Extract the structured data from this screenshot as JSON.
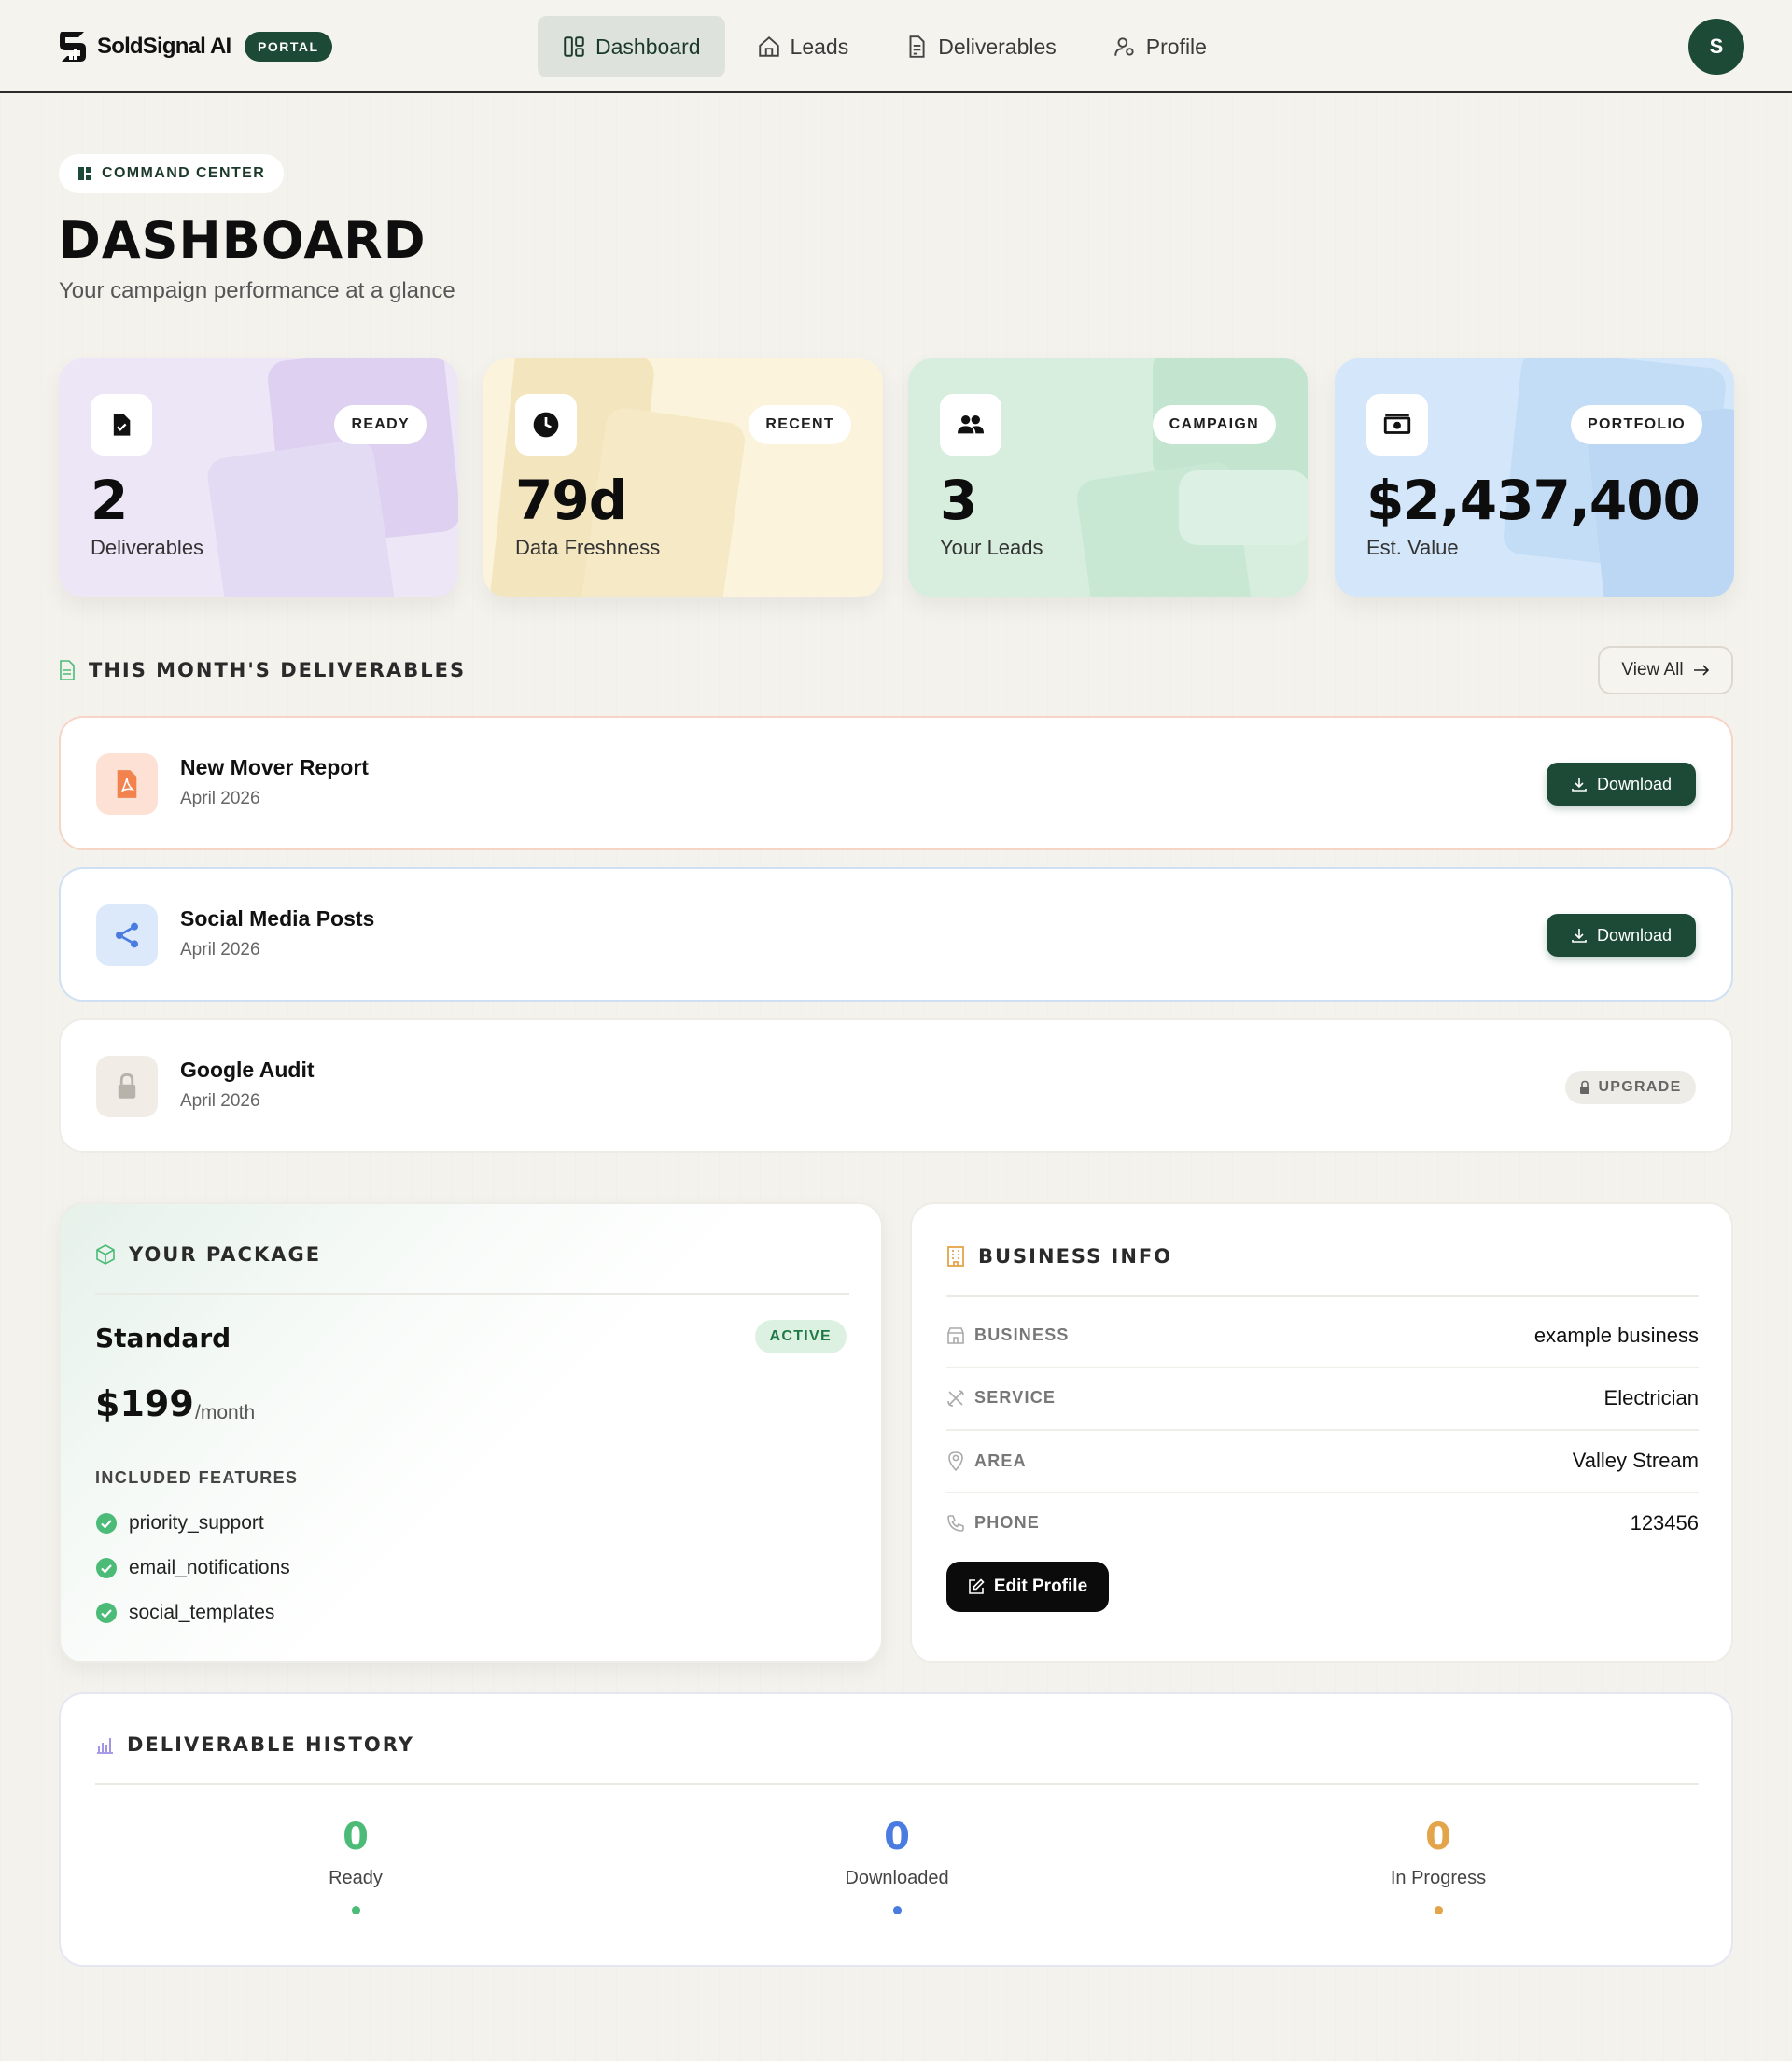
{
  "header": {
    "brand": "SoldSignal AI",
    "portal_badge": "PORTAL",
    "nav": [
      {
        "label": "Dashboard",
        "icon": "layout-icon",
        "active": true
      },
      {
        "label": "Leads",
        "icon": "home-icon",
        "active": false
      },
      {
        "label": "Deliverables",
        "icon": "document-icon",
        "active": false
      },
      {
        "label": "Profile",
        "icon": "user-gear-icon",
        "active": false
      }
    ],
    "avatar_initial": "S"
  },
  "page": {
    "eyebrow": "COMMAND CENTER",
    "title": "DASHBOARD",
    "subtitle": "Your campaign performance at a glance"
  },
  "stats": [
    {
      "tag": "READY",
      "value": "2",
      "label": "Deliverables",
      "icon": "file-check-icon",
      "color": "#ece6f6"
    },
    {
      "tag": "RECENT",
      "value": "79d",
      "label": "Data Freshness",
      "icon": "clock-icon",
      "color": "#fbf3dc"
    },
    {
      "tag": "CAMPAIGN",
      "value": "3",
      "label": "Your Leads",
      "icon": "users-icon",
      "color": "#d7eede"
    },
    {
      "tag": "PORTFOLIO",
      "value": "$2,437,400",
      "label": "Est. Value",
      "icon": "cash-icon",
      "color": "#d3e6fa"
    }
  ],
  "deliverables": {
    "heading": "THIS MONTH'S DELIVERABLES",
    "view_all": "View All",
    "items": [
      {
        "name": "New Mover Report",
        "date": "April 2026",
        "action": "Download",
        "icon": "pdf-icon"
      },
      {
        "name": "Social Media Posts",
        "date": "April 2026",
        "action": "Download",
        "icon": "share-icon"
      },
      {
        "name": "Google Audit",
        "date": "April 2026",
        "action": "UPGRADE",
        "icon": "lock-icon"
      }
    ]
  },
  "package": {
    "heading": "YOUR PACKAGE",
    "name": "Standard",
    "status": "ACTIVE",
    "price": "$199",
    "period": "/month",
    "features_heading": "INCLUDED FEATURES",
    "features": [
      "priority_support",
      "email_notifications",
      "social_templates"
    ]
  },
  "business": {
    "heading": "BUSINESS INFO",
    "rows": [
      {
        "label": "BUSINESS",
        "value": "example business",
        "icon": "building-icon"
      },
      {
        "label": "SERVICE",
        "value": "Electrician",
        "icon": "tools-icon"
      },
      {
        "label": "AREA",
        "value": "Valley Stream",
        "icon": "pin-icon"
      },
      {
        "label": "PHONE",
        "value": "123456",
        "icon": "phone-icon"
      }
    ],
    "edit_label": "Edit Profile"
  },
  "history": {
    "heading": "DELIVERABLE HISTORY",
    "stats": [
      {
        "value": "0",
        "label": "Ready",
        "color": "#4cbb78"
      },
      {
        "value": "0",
        "label": "Downloaded",
        "color": "#4a7be0"
      },
      {
        "value": "0",
        "label": "In Progress",
        "color": "#e3a44a"
      }
    ]
  }
}
